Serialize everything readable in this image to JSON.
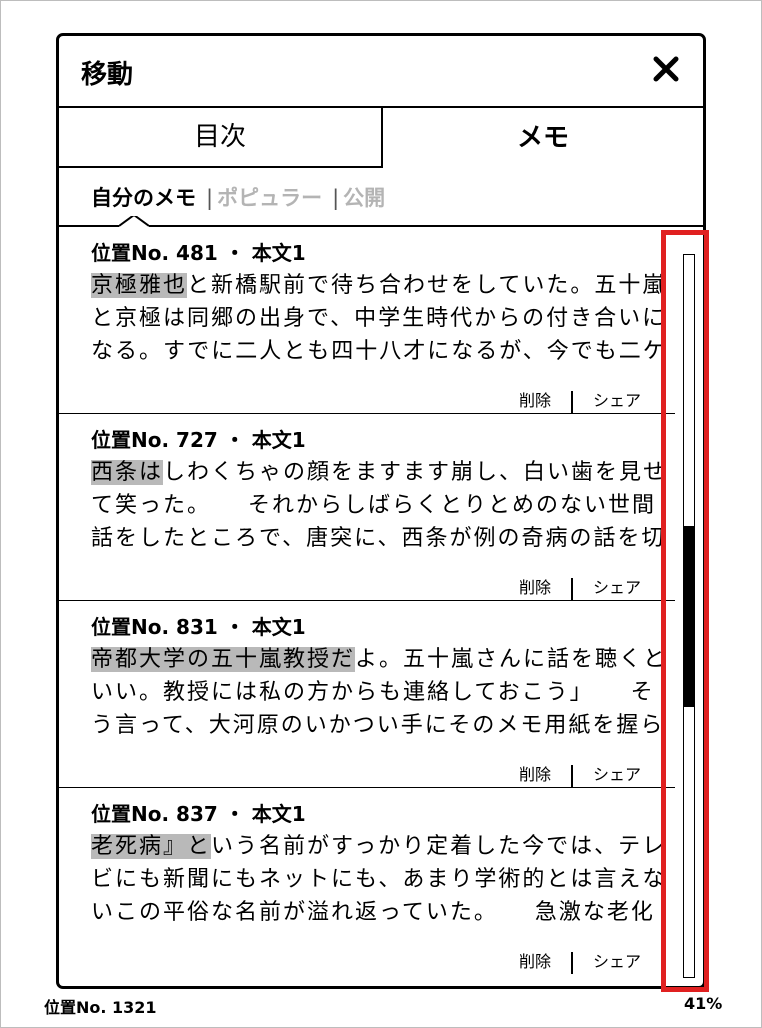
{
  "dialog": {
    "title": "移動",
    "close_icon": "close-icon"
  },
  "tabs": [
    {
      "label": "目次",
      "active": false
    },
    {
      "label": "メモ",
      "active": true
    }
  ],
  "filters": {
    "mine": "自分のメモ",
    "separator": "|",
    "popular": "ポピュラー",
    "public": "公開"
  },
  "notes": [
    {
      "location": "位置No. 481 ・ 本文1",
      "highlight": "京極雅也",
      "line1_rest": "と新橋駅前で待ち合わせをしていた。五十嵐",
      "line2": "と京極は同郷の出身で、中学生時代からの付き合いに",
      "line3": "なる。すでに二人とも四十八才になるが、今でも二ケ",
      "delete_label": "削除",
      "share_label": "シェア"
    },
    {
      "location": "位置No. 727 ・ 本文1",
      "highlight": "西条は",
      "line1_rest": "しわくちゃの顔をますます崩し、白い歯を見せ",
      "line2": "て笑った。　　それからしばらくとりとめのない世間",
      "line3": "話をしたところで、唐突に、西条が例の奇病の話を切",
      "delete_label": "削除",
      "share_label": "シェア"
    },
    {
      "location": "位置No. 831 ・ 本文1",
      "highlight": "帝都大学の五十嵐教授だ",
      "line1_rest": "よ。五十嵐さんに話を聴くと",
      "line2": "いい。教授には私の方からも連絡しておこう」　　そ",
      "line3": "う言って、大河原のいかつい手にそのメモ用紙を握ら",
      "delete_label": "削除",
      "share_label": "シェア"
    },
    {
      "location": "位置No. 837 ・ 本文1",
      "highlight": "老死病』と",
      "line1_rest": "いう名前がすっかり定着した今では、テレ",
      "line2": "ビにも新聞にもネットにも、あまり学術的とは言えな",
      "line3": "いこの平俗な名前が溢れ返っていた。　　急激な老化",
      "delete_label": "削除",
      "share_label": "シェア"
    }
  ],
  "scrollbar": {
    "position_fraction": 0.5,
    "visible_fraction": 0.25
  },
  "footer": {
    "location": "位置No. 1321",
    "percent": "41%"
  },
  "colors": {
    "highlight": "#b9b9b9",
    "annotation_box": "#e02020",
    "dim_text": "#b4b4b4"
  }
}
